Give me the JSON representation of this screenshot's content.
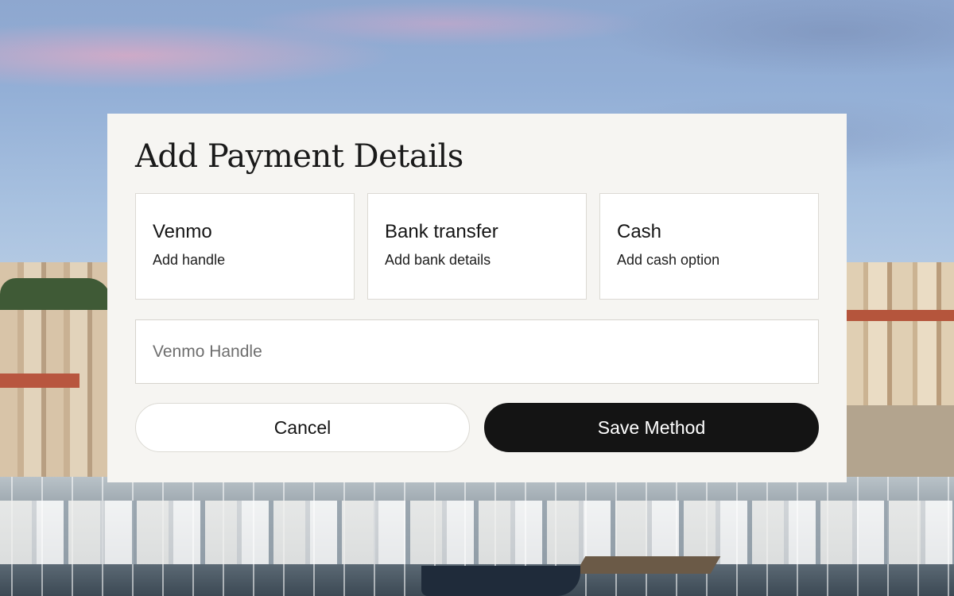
{
  "dialog": {
    "title": "Add Payment Details",
    "methods": [
      {
        "name": "Venmo",
        "description": "Add handle"
      },
      {
        "name": "Bank transfer",
        "description": "Add bank details"
      },
      {
        "name": "Cash",
        "description": "Add cash option"
      }
    ],
    "handle_input": {
      "value": "",
      "placeholder": "Venmo Handle"
    },
    "actions": {
      "cancel_label": "Cancel",
      "save_label": "Save Method"
    }
  },
  "colors": {
    "dialog_background": "#f6f5f2",
    "primary_button": "#141414",
    "card_border": "#dcdad4"
  }
}
